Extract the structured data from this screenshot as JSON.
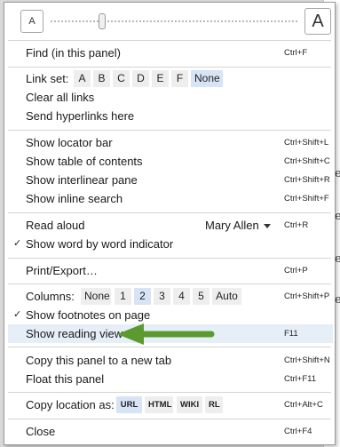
{
  "font_size": {
    "small_label": "A",
    "large_label": "A",
    "slider_level": 0.21
  },
  "menu": {
    "find": {
      "label": "Find (in this panel)",
      "shortcut": "Ctrl+F"
    },
    "link_set": {
      "label": "Link set:",
      "options": [
        "A",
        "B",
        "C",
        "D",
        "E",
        "F",
        "None"
      ],
      "selected": "None"
    },
    "clear_links": {
      "label": "Clear all links"
    },
    "send_hyperlinks": {
      "label": "Send hyperlinks here"
    },
    "locator_bar": {
      "label": "Show locator bar",
      "shortcut": "Ctrl+Shift+L"
    },
    "toc": {
      "label": "Show table of contents",
      "shortcut": "Ctrl+Shift+C"
    },
    "interlinear": {
      "label": "Show interlinear pane",
      "shortcut": "Ctrl+Shift+R"
    },
    "inline_search": {
      "label": "Show inline search",
      "shortcut": "Ctrl+Shift+F"
    },
    "read_aloud": {
      "label": "Read aloud",
      "voice": "Mary Allen",
      "shortcut": "Ctrl+R"
    },
    "word_indicator": {
      "label": "Show word by word indicator",
      "checked": true,
      "check": "✓"
    },
    "print_export": {
      "label": "Print/Export…",
      "shortcut": "Ctrl+P"
    },
    "columns": {
      "label": "Columns:",
      "options": [
        "None",
        "1",
        "2",
        "3",
        "4",
        "5",
        "Auto"
      ],
      "selected": "2",
      "shortcut": "Ctrl+Shift+P"
    },
    "footnotes": {
      "label": "Show footnotes on page",
      "checked": true,
      "check": "✓"
    },
    "reading_view": {
      "label": "Show reading view",
      "shortcut": "F11",
      "highlighted": true
    },
    "copy_panel": {
      "label": "Copy this panel to a new tab",
      "shortcut": "Ctrl+Shift+N"
    },
    "float_panel": {
      "label": "Float this panel",
      "shortcut": "Ctrl+F11"
    },
    "copy_location": {
      "label": "Copy location as:",
      "options": [
        "URL",
        "HTML",
        "WIKI",
        "RL"
      ],
      "selected": "URL",
      "shortcut": "Ctrl+Alt+C"
    },
    "close": {
      "label": "Close",
      "shortcut": "Ctrl+F4"
    }
  },
  "annotation": {
    "arrow_color": "#5a9a2e",
    "target": "reading_view"
  },
  "colors": {
    "highlight": "#e6eef8",
    "selected_chip": "#d6e4f5",
    "chip": "#eeeeee"
  }
}
